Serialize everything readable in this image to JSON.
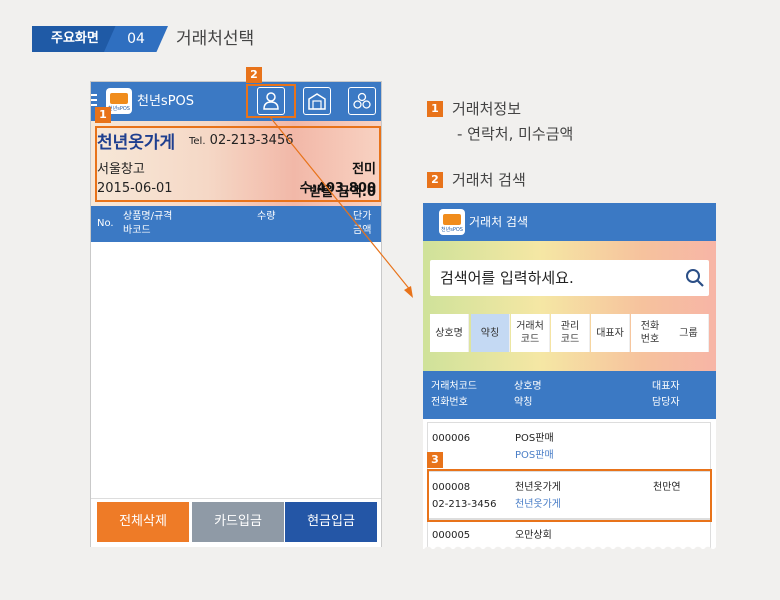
{
  "header": {
    "badge": "주요화면",
    "number": "04",
    "title": "거래처선택"
  },
  "phone1": {
    "app_name": "천년sPOS",
    "logo_text": "천년sPOS",
    "info": {
      "store_name": "천년옷가게",
      "tel_label": "Tel.",
      "tel": "02-213-3456",
      "warehouse": "서울창고",
      "unpaid": "전미수:403,800",
      "date": "2015-06-01",
      "receivable": "받을 금액:0"
    },
    "table_header": {
      "no": "No.",
      "product": "상품명/규격",
      "barcode": "바코드",
      "qty": "수량",
      "unit_price": "단가",
      "amount": "금액"
    },
    "buttons": {
      "delete_all": "전체삭제",
      "card": "카드입금",
      "cash": "현금입금"
    },
    "button_colors": {
      "delete_all": "#ee7b27",
      "card": "#8f9aa6",
      "cash": "#2456a6"
    }
  },
  "markers": {
    "m1": "1",
    "m2": "2",
    "m3": "3"
  },
  "legend": {
    "item1_title": "거래처정보",
    "item1_desc": "- 연락처, 미수금액",
    "item2_title": "거래처 검색"
  },
  "phone2": {
    "title": "거래처 검색",
    "search_placeholder": "검색어를 입력하세요.",
    "tabs": [
      {
        "label": "상호명",
        "active": false
      },
      {
        "label": "약칭",
        "active": true
      },
      {
        "label": "거래처\n코드",
        "active": false
      },
      {
        "label": "관리\n코드",
        "active": false
      },
      {
        "label": "대표자",
        "active": false
      },
      {
        "label": "전화\n번호",
        "active": false
      },
      {
        "label": "그룹",
        "active": false
      }
    ],
    "table_header": {
      "code": "거래처코드",
      "phone": "전화번호",
      "name": "상호명",
      "short": "약칭",
      "rep": "대표자",
      "manager": "담당자"
    },
    "rows": [
      {
        "code": "000006",
        "phone": "",
        "name": "POS판매",
        "short": "POS판매",
        "rep": ""
      },
      {
        "code": "000008",
        "phone": "02-213-3456",
        "name": "천년옷가게",
        "short": "천년옷가게",
        "rep": "천만연"
      },
      {
        "code": "000005",
        "phone": "",
        "name": "오만상회",
        "short": "",
        "rep": ""
      }
    ]
  },
  "colors": {
    "primary": "#3b79c4",
    "accent": "#e8731a",
    "header_dark": "#1f5aa6"
  }
}
